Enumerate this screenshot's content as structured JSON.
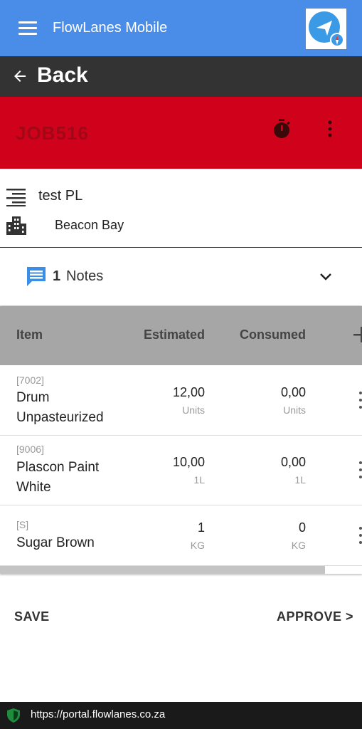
{
  "app": {
    "title": "FlowLanes Mobile",
    "logo_icon": "navigation-compass-icon"
  },
  "nav": {
    "back_label": "Back"
  },
  "job": {
    "id": "JOB516",
    "color": "#d0021b"
  },
  "info": {
    "title": "test PL",
    "location": "Beacon Bay"
  },
  "notes": {
    "count": "1",
    "label": "Notes"
  },
  "table": {
    "columns": [
      "Item",
      "Estimated",
      "Consumed"
    ],
    "rows": [
      {
        "code": "[7002]",
        "name": "Drum Unpasteurized",
        "estimated": "12,00",
        "estimated_unit": "Units",
        "consumed": "0,00",
        "consumed_unit": "Units"
      },
      {
        "code": "[9006]",
        "name": "Plascon Paint White",
        "estimated": "10,00",
        "estimated_unit": "1L",
        "consumed": "0,00",
        "consumed_unit": "1L"
      },
      {
        "code": "[S]",
        "name": "Sugar Brown",
        "estimated": "1",
        "estimated_unit": "KG",
        "consumed": "0",
        "consumed_unit": "KG"
      }
    ]
  },
  "actions": {
    "save": "SAVE",
    "approve": "APPROVE >"
  },
  "browser": {
    "url": "https://portal.flowlanes.co.za"
  },
  "colors": {
    "header": "#4a8de8",
    "back_bar": "#333333",
    "notes_icon": "#3a8ee6",
    "table_header": "#a6a6a6"
  }
}
